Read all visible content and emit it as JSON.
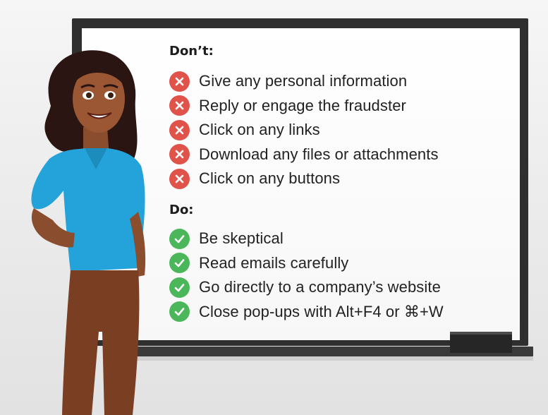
{
  "dont": {
    "heading": "Don’t:",
    "icon": "x-circle-icon",
    "items": [
      {
        "label": "Give any personal information"
      },
      {
        "label": "Reply or engage the fraudster"
      },
      {
        "label": "Click on any links"
      },
      {
        "label": "Download any files or attachments"
      },
      {
        "label": "Click on any buttons"
      }
    ]
  },
  "do": {
    "heading": "Do:",
    "icon": "checkmark-circle-icon",
    "items": [
      {
        "label": "Be skeptical"
      },
      {
        "label": "Read emails carefully"
      },
      {
        "label": "Go directly to a company’s website"
      },
      {
        "label": "Close pop-ups with Alt+F4 or ⌘+W"
      }
    ]
  },
  "colors": {
    "dont_badge": "#e0534b",
    "do_badge": "#4bb75a",
    "board_frame": "#2f2f2f",
    "shirt": "#23a3d9",
    "pants": "#7a3f23"
  }
}
